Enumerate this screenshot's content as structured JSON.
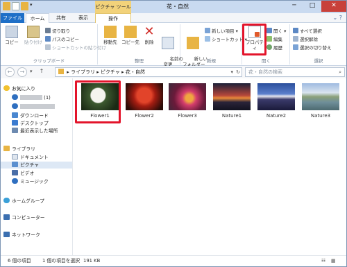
{
  "window": {
    "title": "花・自然",
    "context_tab": "ピクチャ ツール",
    "controls": {
      "minimize": "─",
      "maximize": "□",
      "close": "✕"
    }
  },
  "tabs": {
    "file": "ファイル",
    "home": "ホーム",
    "share": "共有",
    "view": "表示",
    "manage": "操作"
  },
  "ribbon": {
    "clipboard": {
      "label": "クリップボード",
      "copy": "コピー",
      "paste": "貼り付け",
      "cut": "切り取り",
      "copy_path": "パスのコピー",
      "paste_shortcut": "ショートカットの貼り付け"
    },
    "organize": {
      "label": "整理",
      "move_to": "移動先",
      "copy_to": "コピー先",
      "delete": "削除",
      "rename": "名前の\n変更"
    },
    "new": {
      "label": "新規",
      "new_folder": "新しい\nフォルダー",
      "new_item": "新しい項目 ▾",
      "shortcut": "ショートカット ▾"
    },
    "open": {
      "label": "開く",
      "properties": "プロパティ",
      "open": "開く ▾",
      "edit": "編集",
      "history": "履歴"
    },
    "select": {
      "label": "選択",
      "select_all": "すべて選択",
      "select_none": "選択解除",
      "invert": "選択の切り替え"
    }
  },
  "address": {
    "path": "▸  ライブラリ  ▸  ピクチャ  ▸  花・自然",
    "search_placeholder": "花・自然の検索",
    "back": "←",
    "forward": "→",
    "up": "↑",
    "refresh": "↻"
  },
  "nav": {
    "favorites": "お気に入り",
    "fav_unnamed_count": "(1)",
    "downloads": "ダウンロード",
    "desktop": "デスクトップ",
    "recent": "最近表示した場所",
    "libraries": "ライブラリ",
    "documents": "ドキュメント",
    "pictures": "ピクチャ",
    "videos": "ビデオ",
    "music": "ミュージック",
    "homegroup": "ホームグループ",
    "computer": "コンピューター",
    "network": "ネットワーク"
  },
  "files": [
    {
      "name": "Flower1",
      "selected": true
    },
    {
      "name": "Flower2",
      "selected": false
    },
    {
      "name": "Flower3",
      "selected": false
    },
    {
      "name": "Nature1",
      "selected": false
    },
    {
      "name": "Nature2",
      "selected": false
    },
    {
      "name": "Nature3",
      "selected": false
    }
  ],
  "status": {
    "items": "6 個の項目",
    "selected": "1 個の項目を選択",
    "size": "191 KB",
    "view_details": "☷",
    "view_icons": "▦"
  },
  "colors": {
    "highlight": "#e3142b",
    "file_tab": "#1e6fc7",
    "context_tab": "#f2d27a"
  }
}
